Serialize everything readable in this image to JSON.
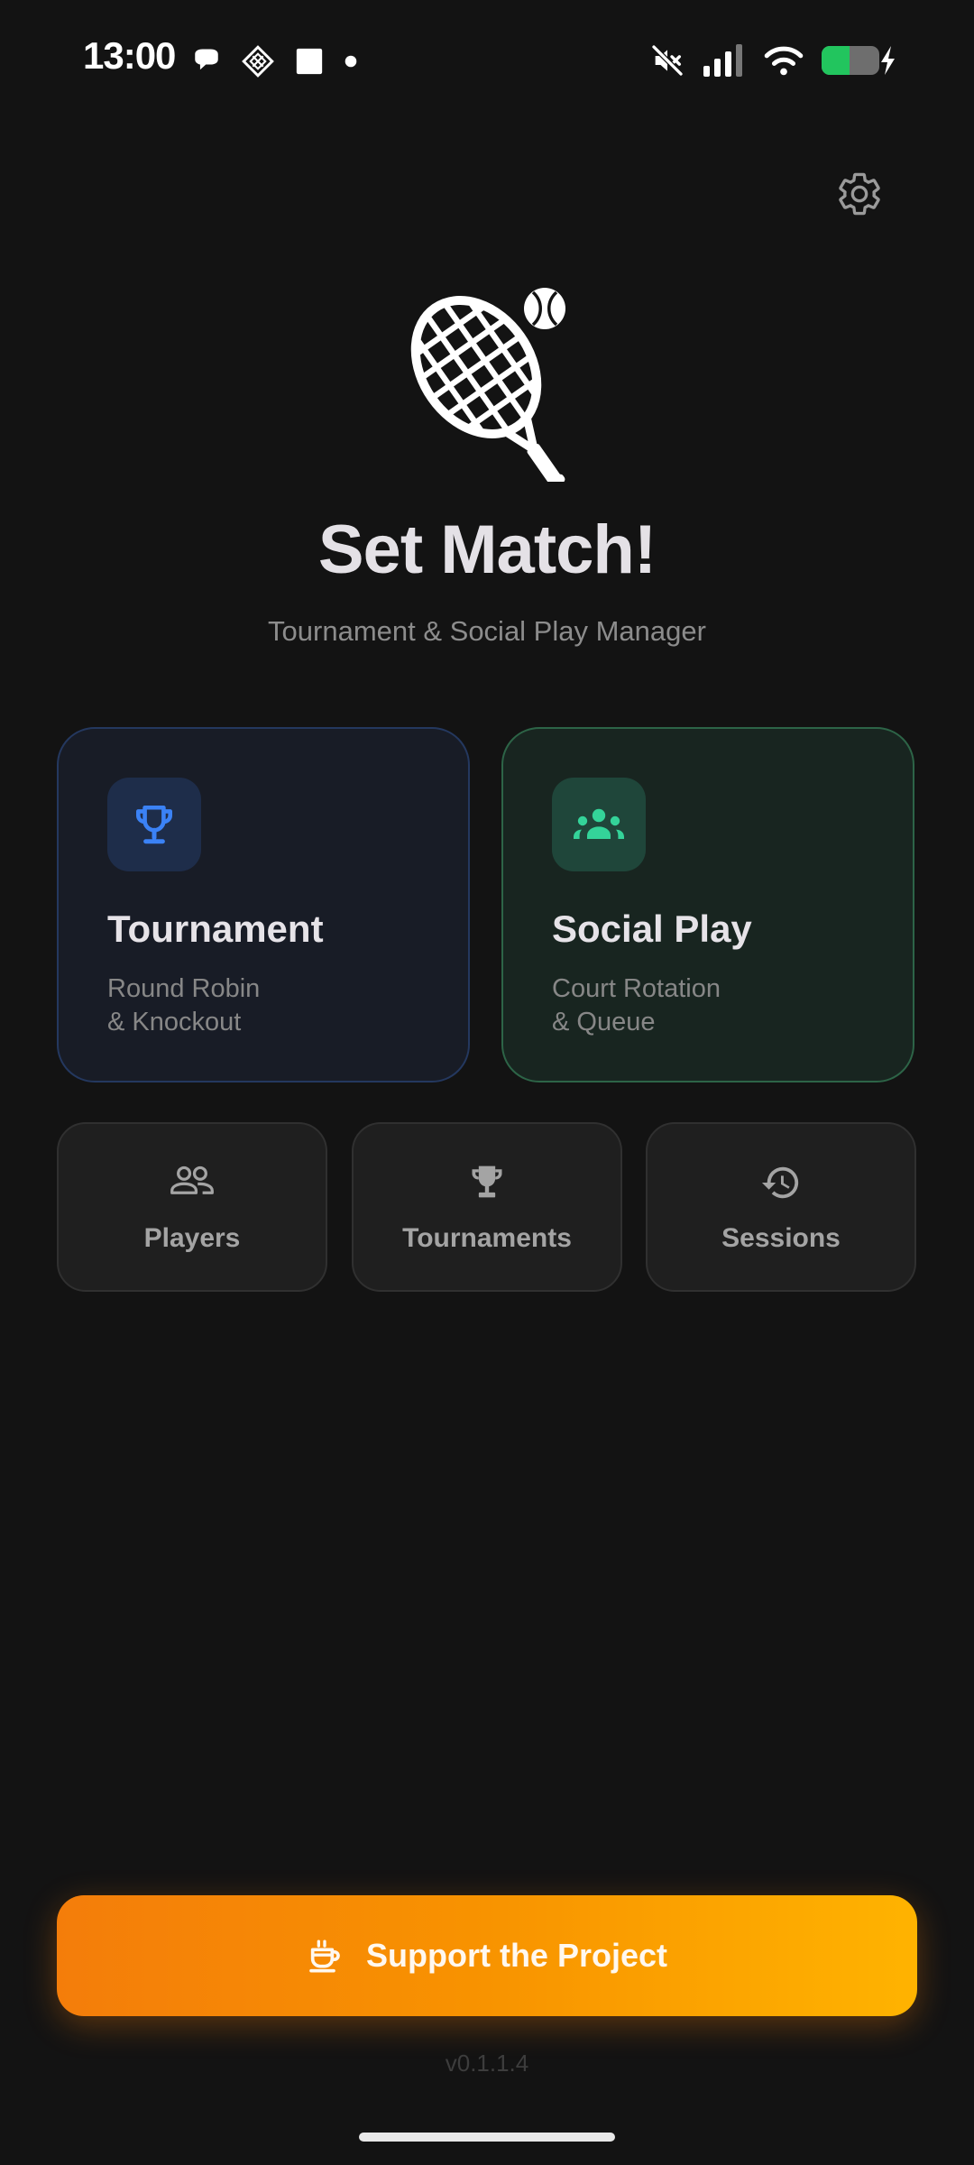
{
  "status_bar": {
    "time": "13:00"
  },
  "app": {
    "title": "Set Match!",
    "subtitle": "Tournament & Social Play Manager"
  },
  "modes": [
    {
      "title": "Tournament",
      "desc_line1": "Round Robin",
      "desc_line2": "& Knockout",
      "icon": "trophy-icon",
      "accent": "#3b82f6"
    },
    {
      "title": "Social Play",
      "desc_line1": "Court Rotation",
      "desc_line2": "& Queue",
      "icon": "groups-icon",
      "accent": "#34d399"
    }
  ],
  "quick_links": [
    {
      "label": "Players",
      "icon": "people-outline-icon"
    },
    {
      "label": "Tournaments",
      "icon": "trophy-icon"
    },
    {
      "label": "Sessions",
      "icon": "history-icon"
    }
  ],
  "support": {
    "label": "Support the Project",
    "icon": "coffee-cup-icon",
    "gradient_start": "#f47d0a",
    "gradient_end": "#ffb300"
  },
  "version": "v0.1.1.4"
}
